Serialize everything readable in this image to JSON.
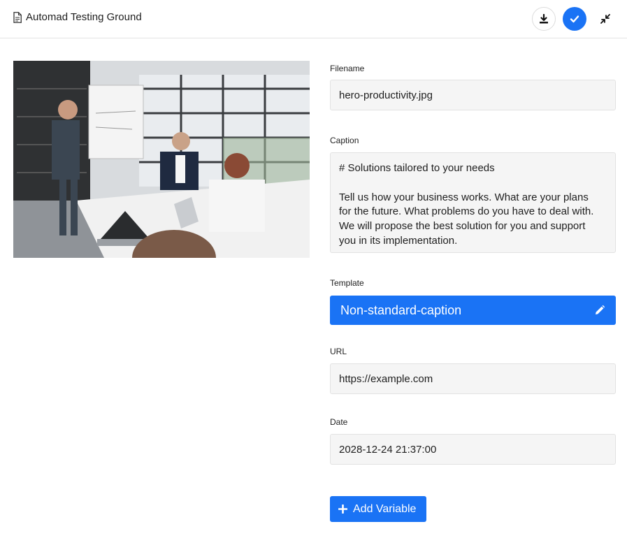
{
  "header": {
    "title": "Automad Testing Ground",
    "title_icon": "document-icon",
    "buttons": {
      "download_icon": "download-icon",
      "save_icon": "check-icon",
      "collapse_icon": "compress-icon"
    }
  },
  "image": {
    "subject": "photo-meeting-room"
  },
  "fields": {
    "filename": {
      "label": "Filename",
      "value": "hero-productivity.jpg"
    },
    "caption": {
      "label": "Caption",
      "value": "# Solutions tailored to your needs\n\nTell us how your business works. What are your plans\nfor the future. What problems do you have to deal with.\nWe will propose the best solution for you and support\nyou in its implementation."
    },
    "template": {
      "label": "Template",
      "value": "Non-standard-caption",
      "icon": "pencil-icon"
    },
    "url": {
      "label": "URL",
      "value": "https://example.com"
    },
    "date": {
      "label": "Date",
      "value": "2028-12-24 21:37:00"
    }
  },
  "actions": {
    "add_variable_label": "Add Variable",
    "add_variable_icon": "plus-icon"
  },
  "colors": {
    "accent": "#1a73f5",
    "field_bg": "#f5f5f5",
    "border": "#e2e2e2"
  }
}
